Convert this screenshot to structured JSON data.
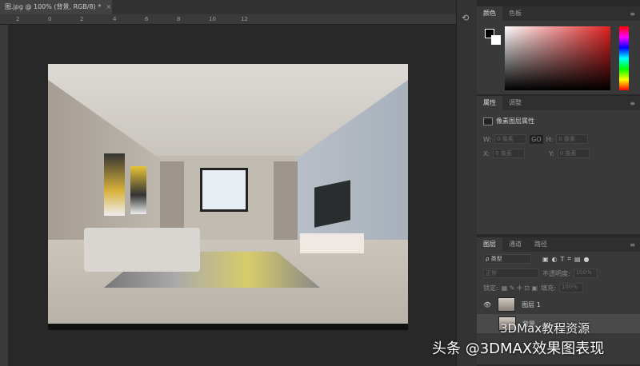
{
  "document_tab": {
    "title": "图.jpg @ 100% (背景, RGB/8) *",
    "close": "×"
  },
  "ruler_ticks": [
    "2",
    "0",
    "2",
    "4",
    "6",
    "8",
    "10",
    "12"
  ],
  "color_panel": {
    "tabs": [
      "颜色",
      "色板"
    ],
    "hue_color": "#e02020"
  },
  "properties_panel": {
    "tabs": [
      "属性",
      "调整"
    ],
    "title": "像素图层属性",
    "w_label": "W:",
    "h_label": "H:",
    "x_label": "X:",
    "y_label": "Y:",
    "w_value": "0 像素",
    "h_value": "0 像素",
    "x_value": "0 像素",
    "y_value": "0 像素",
    "link": "GO"
  },
  "layers_panel": {
    "tabs": [
      "图层",
      "通道",
      "路径"
    ],
    "filter_kind": "ρ 类型",
    "blend_mode": "正常",
    "opacity_label": "不透明度:",
    "opacity_value": "100%",
    "lock_label": "锁定:",
    "fill_label": "填充:",
    "fill_value": "100%",
    "layers": [
      {
        "name": "图层 1",
        "visible": true
      },
      {
        "name": "背景",
        "visible": false
      }
    ]
  },
  "watermark": {
    "line1": "3DMax教程资源",
    "line2": "头条 @3DMAX效果图表现"
  }
}
